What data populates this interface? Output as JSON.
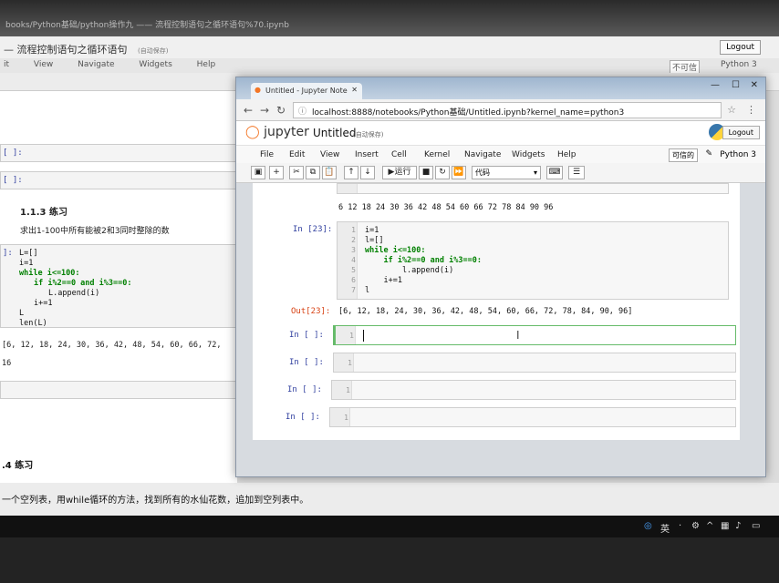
{
  "background_window": {
    "url_text": "books/Python基础/python操作九 —— 流程控制语句之循环语句%70.ipynb",
    "title": "— 流程控制语句之循环语句",
    "autosave": "(自动保存)",
    "logout": "Logout",
    "trusted": "不可信",
    "kernel": "Python 3",
    "menu": [
      "it",
      "View",
      "Navigate",
      "Widgets",
      "Help"
    ],
    "prompts": [
      "[ ]:",
      "[ ]:",
      "]:"
    ],
    "section": "1.1.3 练习",
    "task": "求出1-100中所有能被2和3同时整除的数",
    "code_lines": [
      "L=[]",
      "i=1",
      "while i<=100:",
      "if i%2==0 and i%3==0:",
      "L.append(i)",
      "i+=1",
      "L",
      "len(L)"
    ],
    "output_partial": "[6, 12, 18, 24, 30, 36, 42, 48, 54, 60, 66, 72,",
    "output_len": "16",
    "section2": ".4 练习",
    "task2": "一个空列表，用while循环的方法，找到所有的水仙花数，追加到空列表中。"
  },
  "browser": {
    "tab_title": "Untitled - Jupyter Note",
    "url": "localhost:8888/notebooks/Python基础/Untitled.ipynb?kernel_name=python3",
    "secure_icon": "ⓘ"
  },
  "jupyter": {
    "logo": "jupyter",
    "notebook_name": "Untitled",
    "autosave": "(自动保存)",
    "logout": "Logout",
    "menu": [
      "File",
      "Edit",
      "View",
      "Insert",
      "Cell",
      "Kernel",
      "Navigate",
      "Widgets",
      "Help"
    ],
    "trusted": "可信的",
    "kernel": "Python 3",
    "toolbar": {
      "run_label": "运行",
      "cell_type": "代码"
    },
    "top_output": "6 12 18 24 30 36 42 48 54 60 66 72 78 84 90 96",
    "cell23": {
      "prompt": "In  [23]:",
      "lines": [
        "i=1",
        "l=[]",
        "while i<=100:",
        "    if i%2==0 and i%3==0:",
        "        l.append(i)",
        "    i+=1",
        "l"
      ],
      "out_prompt": "Out[23]:",
      "output": "[6, 12, 18, 24, 30, 36, 42, 48, 54, 60, 66, 72, 78, 84, 90, 96]"
    },
    "empty_cells": [
      {
        "prompt": "In  [ ]:",
        "line": "1"
      },
      {
        "prompt": "In  [ ]:",
        "line": "1"
      },
      {
        "prompt": "In  [ ]:",
        "line": "1"
      },
      {
        "prompt": "In  [ ]:",
        "line": "1"
      }
    ]
  },
  "taskbar": {
    "ime": "英"
  }
}
